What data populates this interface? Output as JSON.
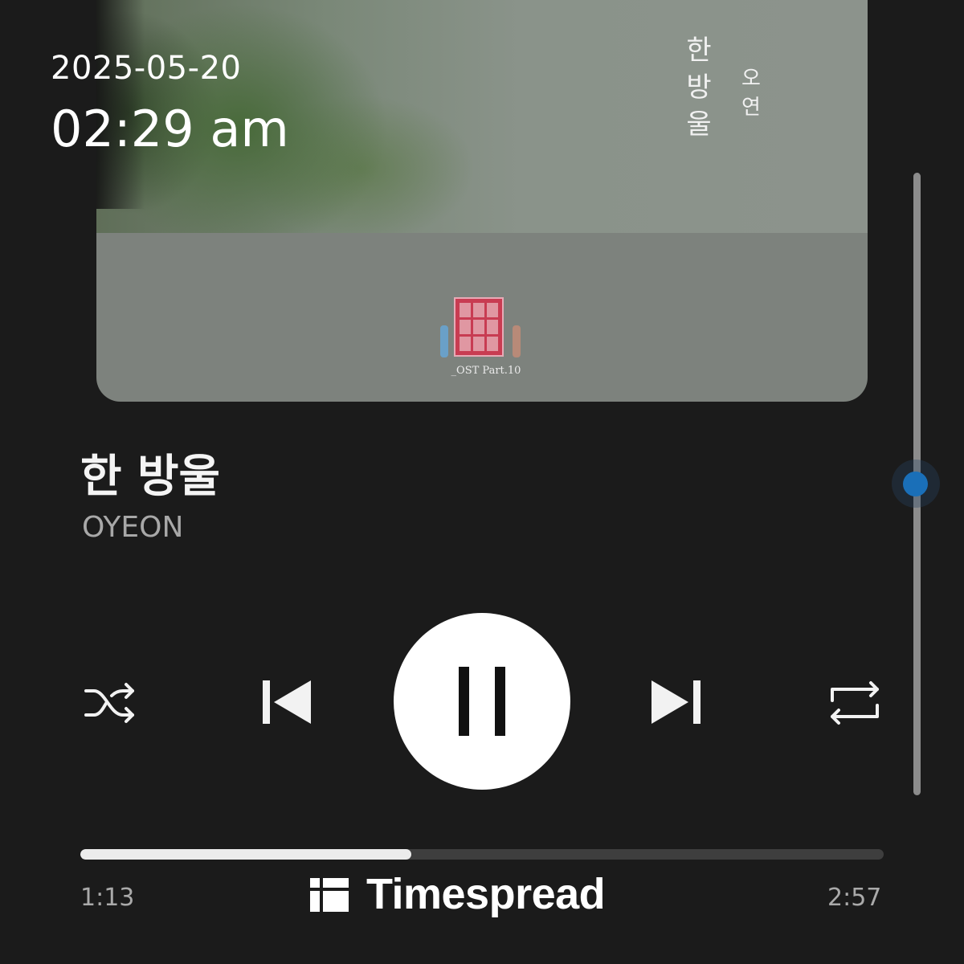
{
  "album_art": {
    "title_vertical": "한방울",
    "artist_vertical": "오연",
    "ost_label": "_OST Part.10"
  },
  "clock": {
    "date": "2025-05-20",
    "time": "02:29 am"
  },
  "track": {
    "title": "한 방울",
    "artist": "OYEON"
  },
  "volume": {
    "level": 0.5
  },
  "controls": {
    "shuffle": "shuffle-icon",
    "previous": "skip-previous-icon",
    "play_pause": "pause-icon",
    "next": "skip-next-icon",
    "repeat": "repeat-icon"
  },
  "progress": {
    "current": "1:13",
    "total": "2:57",
    "fraction": 0.412
  },
  "watermark": {
    "text": "Timespread"
  },
  "colors": {
    "accent": "#1a6fb8",
    "background": "#1b1b1b",
    "progress_fill": "#ececec"
  }
}
